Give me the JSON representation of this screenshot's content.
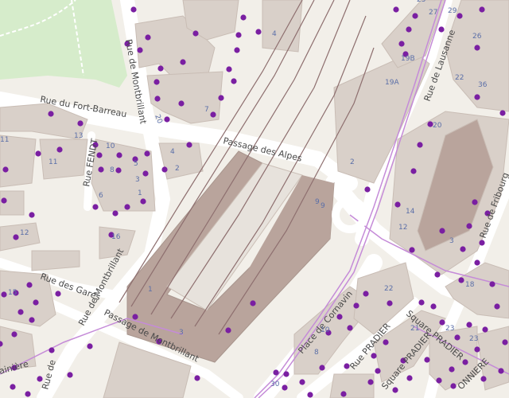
{
  "colors": {
    "background": "#f2efe9",
    "park": "#d6eccb",
    "building": "#d9d0c9",
    "building_dark": "#b9a49c",
    "road": "#ffffff",
    "rail": "#8e6f6f",
    "tram": "#c58bd8",
    "marker": "#7a1fa2"
  },
  "streets": [
    {
      "id": "rue-du-fort-barreau",
      "label": "Rue du Fort-Barreau"
    },
    {
      "id": "rue-de-montbrillant-top",
      "label": "Rue de Montbrillant"
    },
    {
      "id": "rue-de-montbrillant-mid",
      "label": "Rue de Montbrillant"
    },
    {
      "id": "passage-des-alpes",
      "label": "Passage des Alpes"
    },
    {
      "id": "passage-de-montbrillant",
      "label": "Passage de Montbrillant"
    },
    {
      "id": "rue-de-lausanne",
      "label": "Rue de Lausanne"
    },
    {
      "id": "rue-de-fribourg",
      "label": "Rue de Fribourg"
    },
    {
      "id": "place-de-cornavin",
      "label": "Place de Cornavin"
    },
    {
      "id": "rue-pradier",
      "label": "Rue PRADIER"
    },
    {
      "id": "square-pradier-1",
      "label": "Square PRADIER"
    },
    {
      "id": "square-pradier-2",
      "label": "Square PRADIER"
    },
    {
      "id": "rue-fendt",
      "label": "Rue FENDT"
    },
    {
      "id": "rue-des-gares",
      "label": "Rue des Gares"
    },
    {
      "id": "rue-de-la-servette",
      "label": "Rue de"
    },
    {
      "id": "rue-bottom-left",
      "label": "ainière"
    },
    {
      "id": "rue-bottom-right",
      "label": "ONNIERE"
    }
  ],
  "house_numbers": [
    {
      "id": "n4a",
      "label": "4"
    },
    {
      "id": "n7",
      "label": "7"
    },
    {
      "id": "n20",
      "label": "20"
    },
    {
      "id": "n19B",
      "label": "19B"
    },
    {
      "id": "n19A",
      "label": "19A"
    },
    {
      "id": "n2",
      "label": "2"
    },
    {
      "id": "n11",
      "label": "11"
    },
    {
      "id": "n10",
      "label": "10"
    },
    {
      "id": "n8",
      "label": "8"
    },
    {
      "id": "n6",
      "label": "6"
    },
    {
      "id": "n5",
      "label": "5"
    },
    {
      "id": "n3",
      "label": "3"
    },
    {
      "id": "n1",
      "label": "1"
    },
    {
      "id": "n4b",
      "label": "4"
    },
    {
      "id": "n2b",
      "label": "2"
    },
    {
      "id": "n13",
      "label": "13"
    },
    {
      "id": "n11b",
      "label": "11"
    },
    {
      "id": "n9",
      "label": "9"
    },
    {
      "id": "n14",
      "label": "14"
    },
    {
      "id": "n12",
      "label": "12"
    },
    {
      "id": "n22",
      "label": "22"
    },
    {
      "id": "n20b",
      "label": "20"
    },
    {
      "id": "n18",
      "label": "18"
    },
    {
      "id": "n36",
      "label": "36"
    },
    {
      "id": "n29",
      "label": "29"
    },
    {
      "id": "n27",
      "label": "27"
    },
    {
      "id": "n25",
      "label": "25"
    },
    {
      "id": "n26",
      "label": "26"
    },
    {
      "id": "n23",
      "label": "23"
    },
    {
      "id": "n21",
      "label": "21"
    },
    {
      "id": "n10b",
      "label": "10"
    },
    {
      "id": "n8b",
      "label": "8"
    },
    {
      "id": "n1b",
      "label": "1"
    },
    {
      "id": "n3b",
      "label": "3"
    },
    {
      "id": "n22b",
      "label": "22"
    },
    {
      "id": "n15",
      "label": "15"
    },
    {
      "id": "n12b",
      "label": "12"
    },
    {
      "id": "n9b",
      "label": "9"
    },
    {
      "id": "n3c",
      "label": "3"
    },
    {
      "id": "n23b",
      "label": "23"
    },
    {
      "id": "n16",
      "label": "16"
    },
    {
      "id": "n30",
      "label": "30"
    }
  ]
}
